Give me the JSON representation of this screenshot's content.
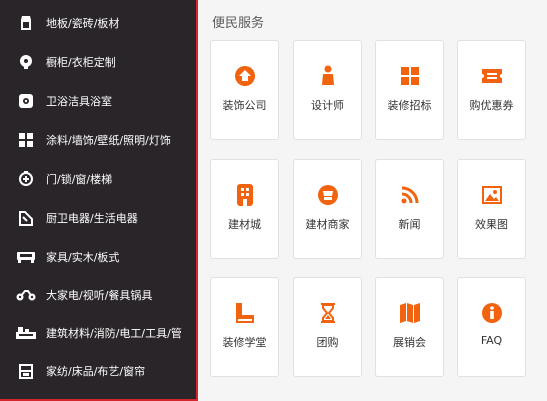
{
  "sidebar": {
    "items": [
      {
        "label": "地板/瓷砖/板材",
        "icon": "floor-icon"
      },
      {
        "label": "橱柜/衣柜定制",
        "icon": "cabinet-icon"
      },
      {
        "label": "卫浴洁具浴室",
        "icon": "bath-icon"
      },
      {
        "label": "涂料/墙饰/壁纸/照明/灯饰",
        "icon": "wall-decor-icon"
      },
      {
        "label": "门/锁/窗/楼梯",
        "icon": "door-lock-icon"
      },
      {
        "label": "厨卫电器/生活电器",
        "icon": "appliance-icon"
      },
      {
        "label": "家具/实木/板式",
        "icon": "furniture-icon"
      },
      {
        "label": "大家电/视听/餐具锅具",
        "icon": "tv-icon"
      },
      {
        "label": "建筑材料/消防/电工/工具/管",
        "icon": "building-material-icon"
      },
      {
        "label": "家纺/床品/布艺/窗帘",
        "icon": "textile-icon"
      }
    ]
  },
  "services": {
    "title": "便民服务",
    "items": [
      {
        "label": "装饰公司",
        "icon": "decoration-company-icon"
      },
      {
        "label": "设计师",
        "icon": "designer-icon"
      },
      {
        "label": "装修招标",
        "icon": "bidding-icon"
      },
      {
        "label": "购优惠券",
        "icon": "coupon-icon"
      },
      {
        "label": "建材城",
        "icon": "building-mall-icon"
      },
      {
        "label": "建材商家",
        "icon": "merchant-icon"
      },
      {
        "label": "新闻",
        "icon": "news-rss-icon"
      },
      {
        "label": "效果图",
        "icon": "gallery-image-icon"
      },
      {
        "label": "装修学堂",
        "icon": "school-book-icon"
      },
      {
        "label": "团购",
        "icon": "hourglass-icon"
      },
      {
        "label": "展销会",
        "icon": "expo-icon"
      },
      {
        "label": "FAQ",
        "icon": "info-icon"
      }
    ]
  },
  "colors": {
    "accent": "#f2630f",
    "sidebar_bg": "#2a2529",
    "sidebar_border": "#d2262c"
  }
}
